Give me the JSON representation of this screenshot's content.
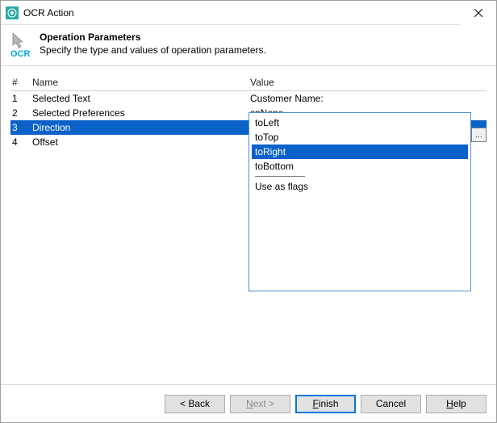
{
  "window": {
    "title": "OCR Action"
  },
  "header": {
    "heading": "Operation Parameters",
    "subheading": "Specify the type and values of operation parameters.",
    "icon_label": "OCR"
  },
  "columns": {
    "idx": "#",
    "name": "Name",
    "value": "Value"
  },
  "rows": [
    {
      "idx": "1",
      "name": "Selected Text",
      "value": "Customer Name:"
    },
    {
      "idx": "2",
      "name": "Selected Preferences",
      "value": "spNone"
    },
    {
      "idx": "3",
      "name": "Direction",
      "value": "toRight"
    },
    {
      "idx": "4",
      "name": "Offset",
      "value": ""
    }
  ],
  "dropdown": {
    "more_label": "...",
    "items": [
      "toLeft",
      "toTop",
      "toRight",
      "toBottom"
    ],
    "extra": "Use as flags",
    "selected": "toRight"
  },
  "buttons": {
    "back": "< Back",
    "next_prefix": "N",
    "next_rest": "ext >",
    "finish_prefix": "F",
    "finish_rest": "inish",
    "cancel": "Cancel",
    "help_prefix": "H",
    "help_rest": "elp"
  }
}
